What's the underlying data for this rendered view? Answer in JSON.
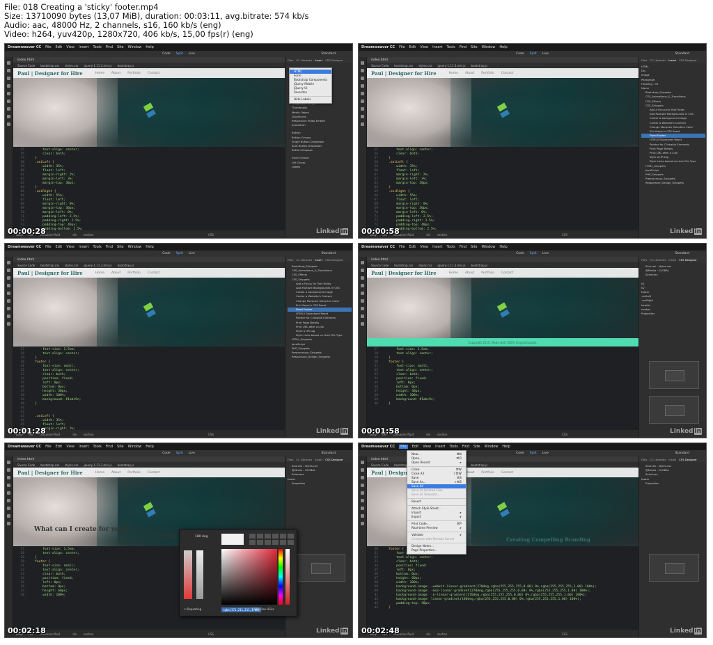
{
  "header": {
    "file": "File: 018 Creating a 'sticky' footer.mp4",
    "size": "Size: 13710090 bytes (13,07 MiB), duration: 00:03:11, avg.bitrate: 574 kb/s",
    "audio": "Audio: aac, 48000 Hz, 2 channels, s16, 160 kb/s (eng)",
    "video": "Video: h264, yuv420p, 1280x720, 406 kb/s, 15,00 fps(r) (eng)"
  },
  "app": {
    "name": "Dreamweaver CC",
    "menu": [
      "File",
      "Edit",
      "View",
      "Insert",
      "Tools",
      "Find",
      "Site",
      "Window",
      "Help"
    ],
    "views": [
      "Code",
      "Split",
      "Live"
    ],
    "workspace": "Standard",
    "doc_name": "index.html",
    "file_tabs": [
      "Source Code",
      "bootstrap.css",
      "styles.css",
      "jquery-1.11.3.min.js",
      "bootstrap.js"
    ],
    "site_title": "Paul | Designer for Hire",
    "nav_links": [
      "Home",
      "About",
      "Portfolio",
      "Contact"
    ],
    "status_tags": [
      "body",
      "div",
      "container-fluid",
      "div",
      "section"
    ],
    "status_lang": "CSS",
    "watermark": "Linked"
  },
  "thumbs": [
    {
      "timestamp": "00:00:28",
      "panel_tabs": [
        "Files",
        "CC Libraries",
        "Insert",
        "CSS Designer"
      ],
      "dropdown": [
        "HTML",
        "Form",
        "Bootstrap Components",
        "jQuery Mobile",
        "jQuery UI",
        "Favorites",
        "Hide Labels"
      ],
      "insert_items": [
        "Carousel",
        "Responsive Image",
        "Thumbnails",
        "Media Object",
        "Glyphicons",
        "Responsive Video Embed",
        "Jumbotron",
        "Button",
        "Button Groups",
        "Single Button Dropdown",
        "Split Button Dropdown",
        "Button Dropups",
        "Input Groups",
        "List Group",
        "Labels"
      ],
      "code": [
        [
          "55",
          "        text-align: center;"
        ],
        [
          "56",
          "        clear: both;"
        ],
        [
          "57",
          "    }"
        ],
        [
          "58",
          "    .aniLeft {"
        ],
        [
          "59",
          "        width: 35%;"
        ],
        [
          "60",
          "        float: left;"
        ],
        [
          "61",
          "        margin-right: 2%;"
        ],
        [
          "62",
          "        margin-left: 3%;"
        ],
        [
          "63",
          "        margin-top: 30px;"
        ],
        [
          "64",
          "    }"
        ],
        [
          "65",
          "    .aniRight {"
        ],
        [
          "66",
          "        width: 55%;"
        ],
        [
          "67",
          "        float: left;"
        ],
        [
          "68",
          "        margin-right: 0%;"
        ],
        [
          "69",
          "        margin-top: 30px;"
        ],
        [
          "70",
          "        margin-left: 0%;"
        ],
        [
          "71",
          "        padding-left: 2.5%;"
        ],
        [
          "72",
          "        padding-right: 2.5%;"
        ],
        [
          "73",
          "        padding-top: 40px;"
        ],
        [
          "74",
          "        padding-bottom: 2.5%;"
        ],
        [
          "75",
          "        background-image: -webkit-linear-gradient(..."
        ]
      ]
    },
    {
      "timestamp": "00:00:58",
      "panel_tabs": [
        "Files",
        "CC Libraries",
        "Insert",
        "CSS Designer"
      ],
      "snippets": [
        "HTML",
        "Div",
        "Image",
        "Paragraph",
        "Heading : H1",
        "Name",
        "Bootstrap_Snippets",
        "CSS_Animations_&_Transitions",
        "CSS_Effects",
        "CSS_Snippets",
        "Add a Focus for Text Fields",
        "Add Multiple Backgrounds in CSS",
        "Center a background image",
        "Center a Website's Content",
        "Change Marquee Selection Color",
        "Eric Meyer's CSS Reset",
        "Fixed Footer",
        "HTML5 Stylesheet Reset",
        "Pointer for Clickable Elements",
        "Print Page Breaks",
        "Print URL after a Link",
        "Style a HR tag",
        "Style Links based on their File Type",
        "HTML_Snippets",
        "JavaScript",
        "PHP_Snippets",
        "Preprocessor_Snippets",
        "Responsive_Design_Snippets"
      ]
    },
    {
      "timestamp": "00:01:28",
      "panel_tabs": [
        "Files",
        "CC Libraries",
        "Insert",
        "CSS Designer"
      ],
      "snippets": [
        "Bootstrap_Snippets",
        "CSS_Animations_&_Transitions",
        "CSS_Effects",
        "CSS_Snippets",
        "Add a Focus for Text Fields",
        "Add Multiple Backgrounds in CSS",
        "Center a background image",
        "Center a Website's Content",
        "Change Marquee Selection Color",
        "Eric Meyer's CSS Reset",
        "Fixed Footer",
        "HTML5 Stylesheet Reset",
        "Pointer for Clickable Elements",
        "Print Page Breaks",
        "Print URL after a Link",
        "Style a HR tag",
        "Style Links based on their File Type",
        "HTML_Snippets",
        "JavaScript",
        "PHP_Snippets",
        "Preprocessor_Snippets",
        "Responsive_Design_Snippets"
      ],
      "code": [
        [
          "27",
          "        font-size: 1.5em;"
        ],
        [
          "28",
          "        text-align: center;"
        ],
        [
          "29",
          "    }"
        ],
        [
          "30",
          "    footer {"
        ],
        [
          "31",
          "        font-size: small;"
        ],
        [
          "32",
          "        text-align: center;"
        ],
        [
          "33",
          "        clear: both;"
        ],
        [
          "34",
          "        position: fixed;"
        ],
        [
          "35",
          "        left: 0px;"
        ],
        [
          "36",
          "        bottom: 0px;"
        ],
        [
          "37",
          "        height: 30px;"
        ],
        [
          "38",
          "        width: 100%;"
        ],
        [
          "39",
          "        background: #1abc9c;"
        ],
        [
          "40",
          "    }"
        ],
        [
          "41",
          ""
        ],
        [
          "42",
          ""
        ],
        [
          "43",
          "    .aniLeft {"
        ],
        [
          "44",
          "        width: 35%;"
        ],
        [
          "45",
          "        float: left;"
        ],
        [
          "46",
          "        margin-right: 2%;"
        ]
      ]
    },
    {
      "timestamp": "00:01:58",
      "panel_tabs": [
        "Files",
        "CC Libraries",
        "Insert",
        "CSS Designer"
      ],
      "footer_text": "Copyright 2015. Made with 100% recycled pixels.",
      "css_sources": [
        "Sources : styles.css",
        "@Media : GLOBAL",
        "Selectors"
      ],
      "css_selectors": [
        "h1",
        "h2",
        "footer",
        ".aniLeft",
        ".aniRight",
        "header",
        "navbar"
      ],
      "properties": "Properties",
      "code": [
        [
          "27",
          "        font-size: 1.5em;"
        ],
        [
          "28",
          "        text-align: center;"
        ],
        [
          "29",
          "    }"
        ],
        [
          "30",
          "    footer {"
        ],
        [
          "31",
          "        font-size: small;"
        ],
        [
          "32",
          "        text-align: center;"
        ],
        [
          "33",
          "        clear: both;"
        ],
        [
          "34",
          "        position: fixed;"
        ],
        [
          "35",
          "        left: 0px;"
        ],
        [
          "36",
          "        bottom: 0px;"
        ],
        [
          "37",
          "        height: 30px;"
        ],
        [
          "38",
          "        width: 100%;"
        ],
        [
          "39",
          "        background: #1abc9c;"
        ],
        [
          "40",
          "    }"
        ]
      ]
    },
    {
      "timestamp": "00:02:18",
      "panel_tabs": [
        "Files",
        "CC Libraries",
        "Insert",
        "CSS Designer"
      ],
      "footer_text": "Copyright 2015. Made with 100% recycled pixels.",
      "headline_left": "What can I create for you?",
      "headline_right": "Creating Co",
      "picker_deg": "180 deg",
      "picker_readout": "rgba(171,211,211,1.00)",
      "picker_modes": "RGBa  Hex  HSLa",
      "picker_repeat": "Repeating",
      "code": [
        [
          "27",
          "        font-size: 1.5em;"
        ],
        [
          "28",
          "        text-align: center;"
        ],
        [
          "29",
          "    }"
        ],
        [
          "30",
          "    footer {"
        ],
        [
          "31",
          "        font-size: small;"
        ],
        [
          "32",
          "        text-align: center;"
        ],
        [
          "33",
          "        clear: both;"
        ],
        [
          "34",
          "        position: fixed;"
        ],
        [
          "35",
          "        left: 0px;"
        ],
        [
          "36",
          "        bottom: 0px;"
        ],
        [
          "37",
          "        height: 60px;"
        ],
        [
          "38",
          "        width: 100%;"
        ]
      ]
    },
    {
      "timestamp": "00:02:48",
      "panel_tabs": [
        "Files",
        "CC Libraries",
        "Insert",
        "CSS Designer"
      ],
      "footer_text": "Copyright 2015. Made with 100% recycled pixels.",
      "headline_right": "Creating Compelling Branding",
      "file_menu": [
        [
          "New...",
          "⌘N"
        ],
        [
          "Open...",
          "⌘O"
        ],
        [
          "Open Recent",
          "▸"
        ],
        [
          "-",
          ""
        ],
        [
          "Close",
          "⌘W"
        ],
        [
          "Close All",
          "⇧⌘W"
        ],
        [
          "Save",
          "⌘S"
        ],
        [
          "Save As...",
          "⇧⌘S"
        ],
        [
          "Save All",
          ""
        ],
        [
          "Save All Related Files",
          ""
        ],
        [
          "Save as Template...",
          ""
        ],
        [
          "-",
          ""
        ],
        [
          "Revert",
          ""
        ],
        [
          "-",
          ""
        ],
        [
          "Attach Style Sheet...",
          ""
        ],
        [
          "Import",
          "▸"
        ],
        [
          "Export",
          "▸"
        ],
        [
          "-",
          ""
        ],
        [
          "Print Code...",
          "⌘P"
        ],
        [
          "Real-time Preview",
          "▸"
        ],
        [
          "-",
          ""
        ],
        [
          "Validate",
          "▸"
        ],
        [
          "Compare with Remote Server",
          ""
        ],
        [
          "-",
          ""
        ],
        [
          "Design Notes...",
          ""
        ],
        [
          "Page Properties...",
          ""
        ]
      ],
      "code": [
        [
          "30",
          "    footer {"
        ],
        [
          "31",
          "        font-size: small;"
        ],
        [
          "32",
          "        text-align: center;"
        ],
        [
          "33",
          "        clear: both;"
        ],
        [
          "34",
          "        position: fixed;"
        ],
        [
          "35",
          "        left: 0px;"
        ],
        [
          "36",
          "        bottom: 0px;"
        ],
        [
          "37",
          "        height: 60px;"
        ],
        [
          "38",
          "        width: 100%;"
        ],
        [
          "39",
          "        background-image: -webkit-linear-gradient(270deg,rgba(255,255,255,0.00) 0%,rgba(255,255,255,1.00) 100%);"
        ],
        [
          "40",
          "        background-image: -moz-linear-gradient(270deg,rgba(255,255,255,0.00) 0%,rgba(255,255,255,1.00) 100%);"
        ],
        [
          "41",
          "        background-image: -o-linear-gradient(270deg,rgba(255,255,255,0.00) 0%,rgba(255,255,255,1.00) 100%);"
        ],
        [
          "42",
          "        background-image: linear-gradient(180deg,rgba(255,255,255,0.00) 0%,rgba(255,255,255,1.00) 100%);"
        ],
        [
          "43",
          "        padding-top: 30px;"
        ],
        [
          "44",
          "    }"
        ]
      ]
    }
  ]
}
